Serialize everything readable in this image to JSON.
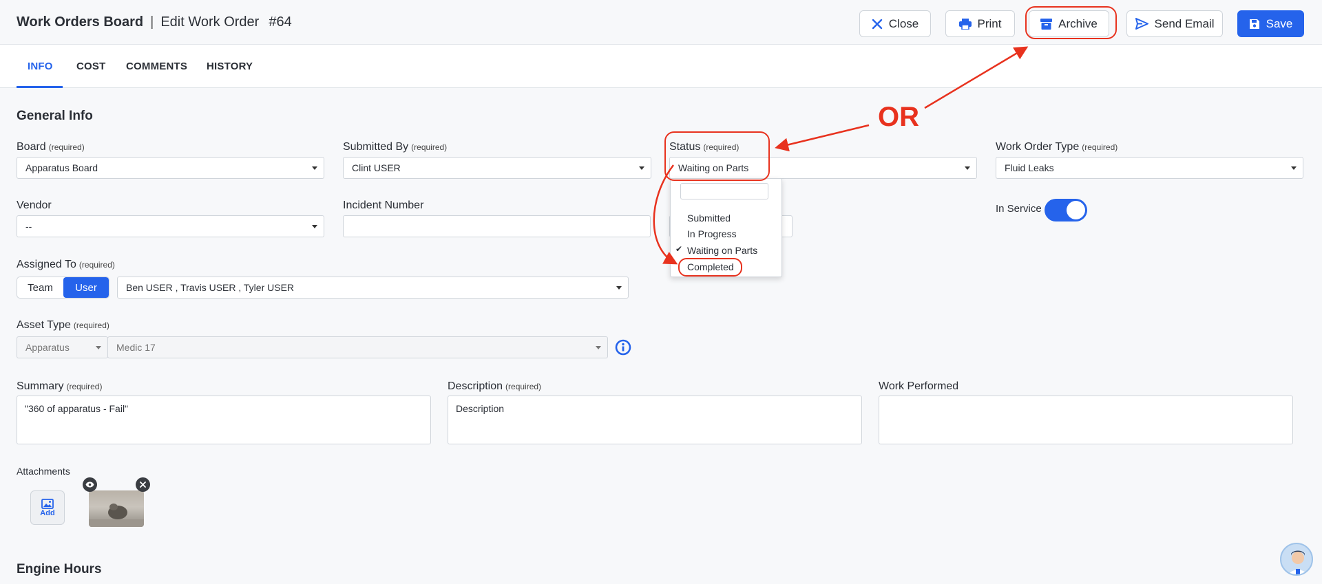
{
  "header": {
    "board_title": "Work Orders Board",
    "separator": "|",
    "edit_title": "Edit Work Order",
    "work_order_number": "#64",
    "buttons": {
      "close": "Close",
      "print": "Print",
      "archive": "Archive",
      "send_email": "Send Email",
      "save": "Save"
    },
    "accent_color": "#2563eb"
  },
  "tabs": [
    {
      "label": "INFO",
      "active": true
    },
    {
      "label": "COST",
      "active": false
    },
    {
      "label": "COMMENTS",
      "active": false
    },
    {
      "label": "HISTORY",
      "active": false
    }
  ],
  "general_info": {
    "section_title": "General Info",
    "required_tag": "(required)",
    "board": {
      "label": "Board",
      "value": "Apparatus Board"
    },
    "submitted_by": {
      "label": "Submitted By",
      "value": "Clint USER"
    },
    "status": {
      "label": "Status",
      "value": "Waiting on Parts",
      "options": [
        "Submitted",
        "In Progress",
        "Waiting on Parts",
        "Completed"
      ],
      "selected_index": 2
    },
    "work_order_type": {
      "label": "Work Order Type",
      "value": "Fluid Leaks"
    },
    "vendor": {
      "label": "Vendor",
      "value": "--"
    },
    "incident_number": {
      "label": "Incident Number",
      "value": ""
    },
    "in_service": {
      "label": "In Service",
      "value": true
    },
    "assigned_to": {
      "label": "Assigned To",
      "modes": [
        "Team",
        "User"
      ],
      "active_mode": "User",
      "value": "Ben USER , Travis USER , Tyler USER"
    },
    "asset_type": {
      "label": "Asset Type",
      "category": "Apparatus",
      "value": "Medic 17"
    },
    "summary": {
      "label": "Summary",
      "value": "\"360 of apparatus - Fail\""
    },
    "description": {
      "label": "Description",
      "value": "Description"
    },
    "work_performed": {
      "label": "Work Performed",
      "value": ""
    },
    "attachments": {
      "label": "Attachments",
      "add_label": "Add"
    }
  },
  "engine_hours": {
    "section_title": "Engine Hours"
  },
  "annotation": {
    "text": "OR",
    "color": "#e8321e"
  },
  "icons": [
    "close-icon",
    "printer-icon",
    "archive-box-icon",
    "send-icon",
    "floppy-disk-icon",
    "info-icon",
    "image-add-icon",
    "eye-icon",
    "remove-icon",
    "check-icon",
    "chevron-down-icon"
  ]
}
